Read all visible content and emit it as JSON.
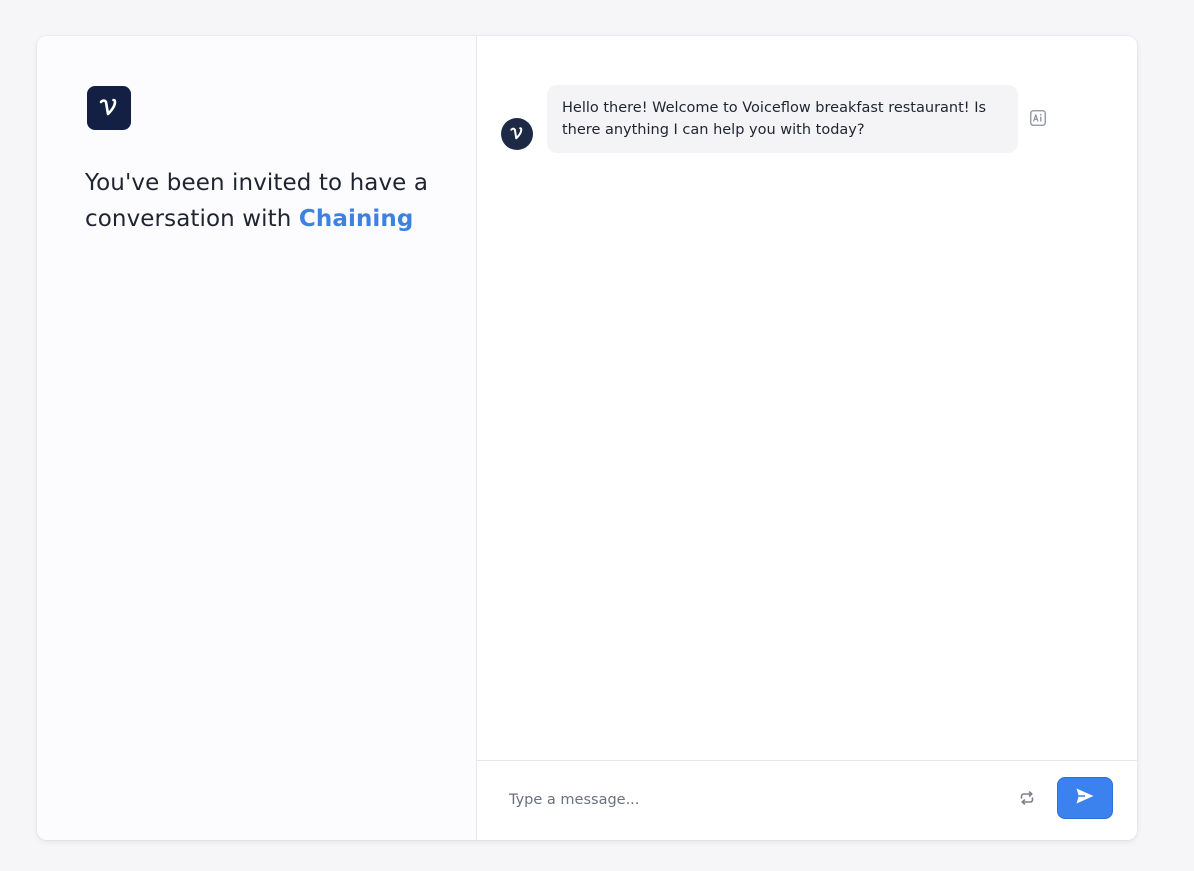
{
  "welcome": {
    "invite_text": "You've been invited to have a conversation with",
    "assistant_name": "Chaining"
  },
  "chat": {
    "messages": [
      {
        "role": "assistant",
        "text": "Hello there! Welcome to Voiceflow breakfast restaurant! Is there anything I can help you with today?"
      }
    ]
  },
  "composer": {
    "placeholder": "Type a message...",
    "value": ""
  },
  "icons": {
    "logo": "voiceflow-logo-icon",
    "avatar": "voiceflow-avatar-icon",
    "ai_badge": "ai-badge-icon",
    "restart": "restart-icon",
    "send": "send-icon"
  },
  "colors": {
    "accent": "#3c82ef",
    "brand_dark": "#132044",
    "assistant_name": "#3d82e0",
    "bubble_bg": "#f4f4f7"
  }
}
